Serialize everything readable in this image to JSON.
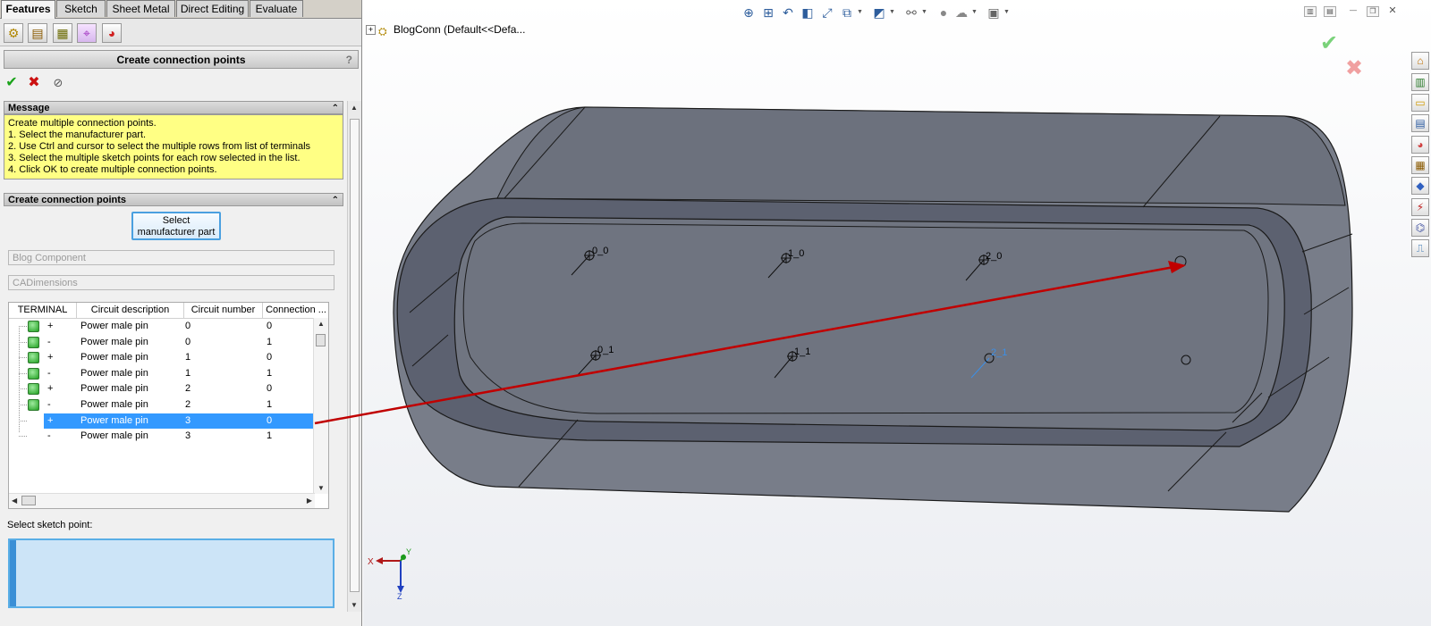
{
  "tabs": [
    "Features",
    "Sketch",
    "Sheet Metal",
    "Direct Editing",
    "Evaluate"
  ],
  "pm_icons": [
    "feature-manager-icon",
    "property-manager-icon",
    "configuration-manager-icon",
    "dimxpert-icon",
    "display-manager-icon"
  ],
  "pm": {
    "title": "Create connection points",
    "help": "?",
    "ok_symbol": "✔",
    "cancel_symbol": "✖",
    "pin_symbol": "⊘"
  },
  "message": {
    "heading": "Message",
    "lines": [
      "Create multiple connection points.",
      "1. Select the manufacturer part.",
      "2. Use Ctrl and cursor to select the multiple rows from list of terminals",
      "3. Select the multiple sketch points for each row selected in the list.",
      "4. Click OK to create multiple connection points."
    ]
  },
  "ccp": {
    "heading": "Create connection points",
    "button_line1": "Select",
    "button_line2": "manufacturer part",
    "field1": "Blog Component",
    "field2": "CADimensions"
  },
  "grid": {
    "columns": [
      "TERMINAL",
      "Circuit description",
      "Circuit number",
      "Connection ..."
    ],
    "rows": [
      {
        "checked": true,
        "sign": "+",
        "desc": "Power male pin",
        "circuit": "0",
        "conn": "0"
      },
      {
        "checked": true,
        "sign": "-",
        "desc": "Power male pin",
        "circuit": "0",
        "conn": "1"
      },
      {
        "checked": true,
        "sign": "+",
        "desc": "Power male pin",
        "circuit": "1",
        "conn": "0"
      },
      {
        "checked": true,
        "sign": "-",
        "desc": "Power male pin",
        "circuit": "1",
        "conn": "1"
      },
      {
        "checked": true,
        "sign": "+",
        "desc": "Power male pin",
        "circuit": "2",
        "conn": "0"
      },
      {
        "checked": true,
        "sign": "-",
        "desc": "Power male pin",
        "circuit": "2",
        "conn": "1"
      },
      {
        "checked": false,
        "sign": "+",
        "desc": "Power male pin",
        "circuit": "3",
        "conn": "0",
        "selected": true
      },
      {
        "checked": false,
        "sign": "-",
        "desc": "Power male pin",
        "circuit": "3",
        "conn": "1"
      }
    ]
  },
  "sketch": {
    "label": "Select sketch point:",
    "value": ""
  },
  "graphics": {
    "tree_label": "BlogConn  (Default<<Defa...",
    "point_labels": [
      "0_0",
      "1_0",
      "2_0",
      "0_1",
      "1_1",
      "2_1"
    ],
    "triad": {
      "x": "X",
      "y": "Y",
      "z": "Z"
    }
  },
  "colors": {
    "message_bg": "#ffff84",
    "selection": "#3399ff",
    "arrow": "#c00000",
    "body_face": "#6a6f7c",
    "highlight_point": "#3c8fe6"
  }
}
